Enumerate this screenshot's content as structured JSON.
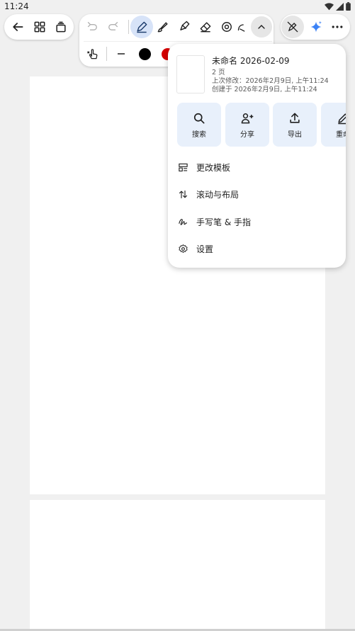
{
  "status_bar": {
    "time": "11:24"
  },
  "toolbar": {
    "back_icon": "arrow-left-icon",
    "grid_icon": "grid-icon",
    "pages_icon": "pages-icon",
    "undo_icon": "undo-icon",
    "redo_icon": "redo-icon",
    "tools": [
      "pen-icon",
      "brush-icon",
      "highlighter-icon",
      "eraser-icon",
      "lasso-icon",
      "shape-icon"
    ],
    "selected_tool": "pen-icon",
    "collapse_icon": "chevron-up-icon",
    "touch_icon": "touch-write-icon",
    "stroke_icon": "stroke-width-icon",
    "colors": [
      "#000000",
      "#d50000"
    ],
    "ai_icon": "sparkle-icon",
    "more_icon": "more-horizontal-icon",
    "accent": "#d7e3f8"
  },
  "popup": {
    "title": "未命名 2026-02-09",
    "page_count": "2 页",
    "modified": "上次修改：2026年2月9日, 上午11:24",
    "created": "创建于 2026年2月9日, 上午11:24",
    "actions": [
      {
        "icon": "search-icon",
        "label": "搜索"
      },
      {
        "icon": "add-person-icon",
        "label": "分享"
      },
      {
        "icon": "upload-icon",
        "label": "导出"
      },
      {
        "icon": "edit-icon",
        "label": "重命"
      }
    ],
    "menu": [
      {
        "icon": "template-icon",
        "label": "更改模板"
      },
      {
        "icon": "swap-vertical-icon",
        "label": "滚动与布局"
      },
      {
        "icon": "handwriting-icon",
        "label": "手写笔 & 手指"
      },
      {
        "icon": "gear-icon",
        "label": "设置"
      }
    ]
  }
}
